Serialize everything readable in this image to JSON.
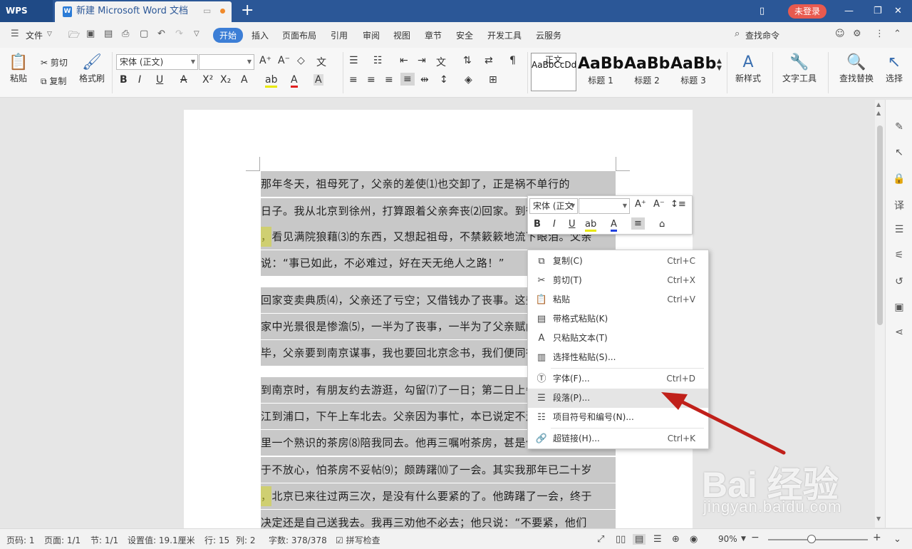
{
  "titlebar": {
    "app_name": "WPS",
    "doc_title": "新建 Microsoft Word 文档",
    "login_label": "未登录",
    "new_tab": "+",
    "icons": [
      "monitor-icon",
      "minimize-icon",
      "restore-icon",
      "close-icon"
    ]
  },
  "menu": {
    "file": "文件",
    "tabs": [
      "开始",
      "插入",
      "页面布局",
      "引用",
      "审阅",
      "视图",
      "章节",
      "安全",
      "开发工具",
      "云服务"
    ],
    "active_tab": "开始",
    "search": "查找命令"
  },
  "ribbon": {
    "paste": "粘贴",
    "cut": "剪切",
    "copy": "复制",
    "format_painter": "格式刷",
    "font_name": "宋体 (正文)",
    "font_size": "",
    "styles": [
      {
        "preview": "AaBbCcDd",
        "label": "正文"
      },
      {
        "preview": "AaBb",
        "label": "标题 1"
      },
      {
        "preview": "AaBb(",
        "label": "标题 2"
      },
      {
        "preview": "AaBbC",
        "label": "标题 3"
      }
    ],
    "new_style": "新样式",
    "text_tools": "文字工具",
    "find_replace": "查找替换",
    "select": "选择"
  },
  "document": {
    "lines": [
      "    那年冬天，祖母死了，父亲的差使⑴也交卸了，正是祸不单行的",
      "日子。我从北京到徐州，打算跟着父亲奔丧⑵回家。到徐州见着父亲",
      "，看见满院狼藉⑶的东西，又想起祖母，不禁簌簌地流下眼泪。父亲",
      "说：“事已如此，不必难过，好在天无绝人之路！”",
      "    回家变卖典质⑷，父亲还了亏空；又借钱办了丧事。这些日子，",
      "家中光景很是惨澹⑸，一半为了丧事，一半为了父亲赋闲。丧事完",
      "毕，父亲要到南京谋事，我也要回北京念书，我们便同行。",
      "    到南京时，有朋友约去游逛，勾留⑺了一日；第二日上午便须渡",
      "江到浦口，下午上车北去。父亲因为事忙，本已说定不送我，叫旅馆",
      "里一个熟识的茶房⑻陪我同去。他再三嘱咐茶房，甚是仔细。但他终",
      "于不放心，怕茶房不妥帖⑼；颇踌躇⑽了一会。其实我那年已二十岁",
      "，北京已来往过两三次，是没有什么要紧的了。他踌躇了一会，终于",
      "决定还是自己送我去。我再三劝他不必去；他只说：“不要紧，他们"
    ]
  },
  "mini_toolbar": {
    "font_name": "宋体 (正文",
    "font_size": ""
  },
  "context_menu": {
    "items": [
      {
        "label": "复制(C)",
        "shortcut": "Ctrl+C",
        "icon": "copy-icon"
      },
      {
        "label": "剪切(T)",
        "shortcut": "Ctrl+X",
        "icon": "scissors-icon"
      },
      {
        "label": "粘贴",
        "shortcut": "Ctrl+V",
        "icon": "paste-icon"
      },
      {
        "label": "带格式粘贴(K)",
        "shortcut": "",
        "icon": "paste-format-icon"
      },
      {
        "label": "只粘贴文本(T)",
        "shortcut": "",
        "icon": "paste-text-icon"
      },
      {
        "label": "选择性粘贴(S)...",
        "shortcut": "",
        "icon": "paste-special-icon"
      },
      {
        "label": "字体(F)...",
        "shortcut": "Ctrl+D",
        "icon": "font-icon"
      },
      {
        "label": "段落(P)...",
        "shortcut": "",
        "icon": "paragraph-icon"
      },
      {
        "label": "项目符号和编号(N)...",
        "shortcut": "",
        "icon": "list-icon"
      },
      {
        "label": "超链接(H)...",
        "shortcut": "Ctrl+K",
        "icon": "link-icon"
      }
    ],
    "hovered_item": "段落(P)..."
  },
  "statusbar": {
    "page_num": "页码: 1",
    "page_count": "页面: 1/1",
    "section": "节: 1/1",
    "position": "设置值: 19.1厘米",
    "row": "行: 15",
    "col": "列: 2",
    "word_count": "字数: 378/378",
    "spell_check": "拼写检查",
    "zoom": "90%"
  },
  "watermark": {
    "logo": "Bai 经验",
    "url": "jingyan.baidu.com"
  },
  "colors": {
    "titlebar": "#2b5797",
    "accent": "#3c7ed6",
    "selection": "#c8c8c8",
    "highlight": "#d6d62a",
    "arrow": "#c0201a",
    "login": "#e85a4f"
  }
}
